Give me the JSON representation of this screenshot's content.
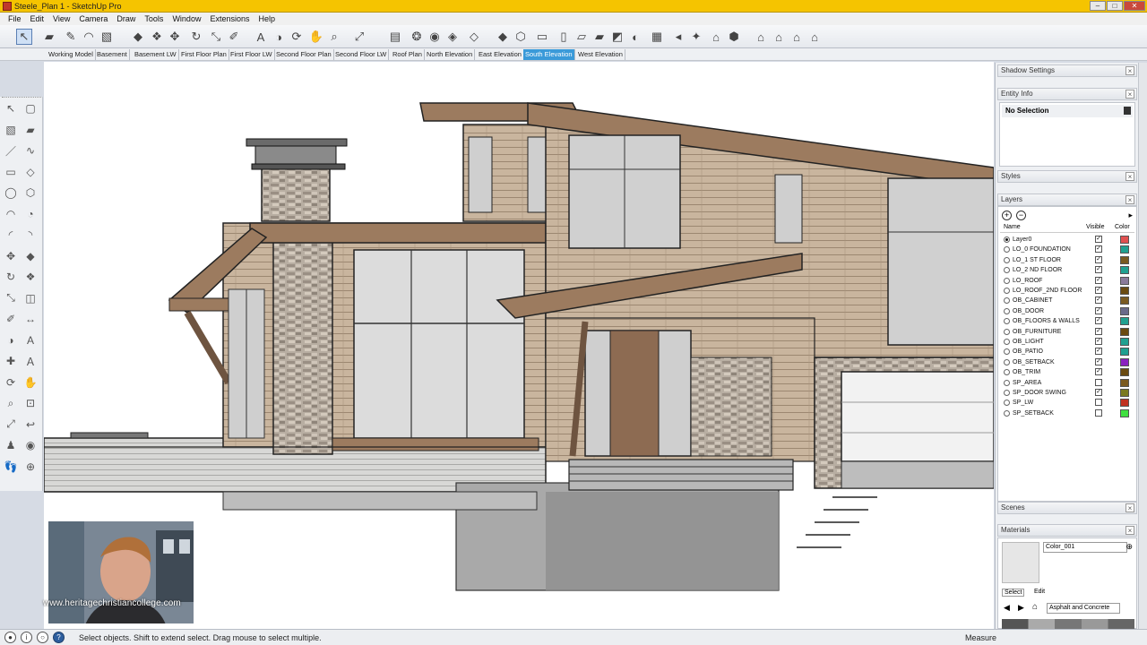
{
  "window": {
    "title": "Steele_Plan 1 - SketchUp Pro",
    "controls": {
      "minimize": "–",
      "maximize": "□",
      "close": "✕"
    }
  },
  "menu": [
    "File",
    "Edit",
    "View",
    "Camera",
    "Draw",
    "Tools",
    "Window",
    "Extensions",
    "Help"
  ],
  "toolbar": {
    "icons": [
      "select-icon",
      "eraser-icon",
      "pencil-icon",
      "arc-icon",
      "paint-bucket-icon",
      "push-pull-icon",
      "follow-me-icon",
      "move-icon",
      "rotate-icon",
      "scale-icon",
      "tape-measure-icon",
      "text-icon",
      "protractor-icon",
      "orbit-icon",
      "pan-icon",
      "zoom-icon",
      "zoom-extents-icon",
      "model-info-icon",
      "components-icon",
      "materials-icon",
      "styles-icon",
      "section-plane-icon",
      "section-cut-icon",
      "iso-view-icon",
      "top-view-icon",
      "front-view-icon",
      "right-view-icon",
      "back-view-icon",
      "left-view-icon",
      "shadows-icon",
      "fog-icon",
      "sound-icon",
      "light-icon",
      "warehouse-icon",
      "extension-icon",
      "house-icon",
      "house-alt-icon",
      "house-outline-icon",
      "barn-icon"
    ]
  },
  "scenes": {
    "tabs": [
      "Working Model",
      "Basement",
      "Basement LW",
      "First Floor Plan",
      "First Floor LW",
      "Second Floor Plan",
      "Second Floor LW",
      "Roof Plan",
      "North Elevation",
      "East Elevation",
      "South Elevation",
      "West Elevation"
    ],
    "active": "South Elevation"
  },
  "right_panel": {
    "shadow_settings": "Shadow Settings",
    "entity_info": "Entity Info",
    "entity_value": "No Selection",
    "styles": "Styles",
    "layers": {
      "title": "Layers",
      "col_name": "Name",
      "col_visible": "Visible",
      "col_color": "Color",
      "rows": [
        {
          "name": "Layer0",
          "active": true,
          "visible": true,
          "color": "#e05050"
        },
        {
          "name": "LO_0 FOUNDATION",
          "active": false,
          "visible": true,
          "color": "#20a090"
        },
        {
          "name": "LO_1 ST FLOOR",
          "active": false,
          "visible": true,
          "color": "#7a5a20"
        },
        {
          "name": "LO_2 ND FLOOR",
          "active": false,
          "visible": true,
          "color": "#20a090"
        },
        {
          "name": "LO_ROOF",
          "active": false,
          "visible": true,
          "color": "#8a7a9a"
        },
        {
          "name": "LO_ROOF_2ND FLOOR",
          "active": false,
          "visible": true,
          "color": "#6a4a10"
        },
        {
          "name": "OB_CABINET",
          "active": false,
          "visible": true,
          "color": "#7a5a20"
        },
        {
          "name": "OB_DOOR",
          "active": false,
          "visible": true,
          "color": "#6a6a8a"
        },
        {
          "name": "OB_FLOORS & WALLS",
          "active": false,
          "visible": true,
          "color": "#20a090"
        },
        {
          "name": "OB_FURNITURE",
          "active": false,
          "visible": true,
          "color": "#6a4a10"
        },
        {
          "name": "OB_LIGHT",
          "active": false,
          "visible": true,
          "color": "#20a090"
        },
        {
          "name": "OB_PATIO",
          "active": false,
          "visible": true,
          "color": "#20a090"
        },
        {
          "name": "OB_SETBACK",
          "active": false,
          "visible": true,
          "color": "#8a20c0"
        },
        {
          "name": "OB_TRIM",
          "active": false,
          "visible": true,
          "color": "#6a4a10"
        },
        {
          "name": "SP_AREA",
          "active": false,
          "visible": false,
          "color": "#7a5a20"
        },
        {
          "name": "SP_DOOR SWING",
          "active": false,
          "visible": true,
          "color": "#7a7a20"
        },
        {
          "name": "SP_LW",
          "active": false,
          "visible": false,
          "color": "#c03020"
        },
        {
          "name": "SP_SETBACK",
          "active": false,
          "visible": false,
          "color": "#40e040"
        }
      ]
    },
    "scenes": "Scenes",
    "materials": {
      "title": "Materials",
      "current": "Color_001",
      "tab_select": "Select",
      "tab_edit": "Edit",
      "library": "Asphalt and Concrete"
    }
  },
  "webcam": {
    "watermark": "www.heritagechristiancollege.com"
  },
  "status": {
    "text": "Select objects. Shift to extend select. Drag mouse to select multiple.",
    "measure": "Measure"
  }
}
